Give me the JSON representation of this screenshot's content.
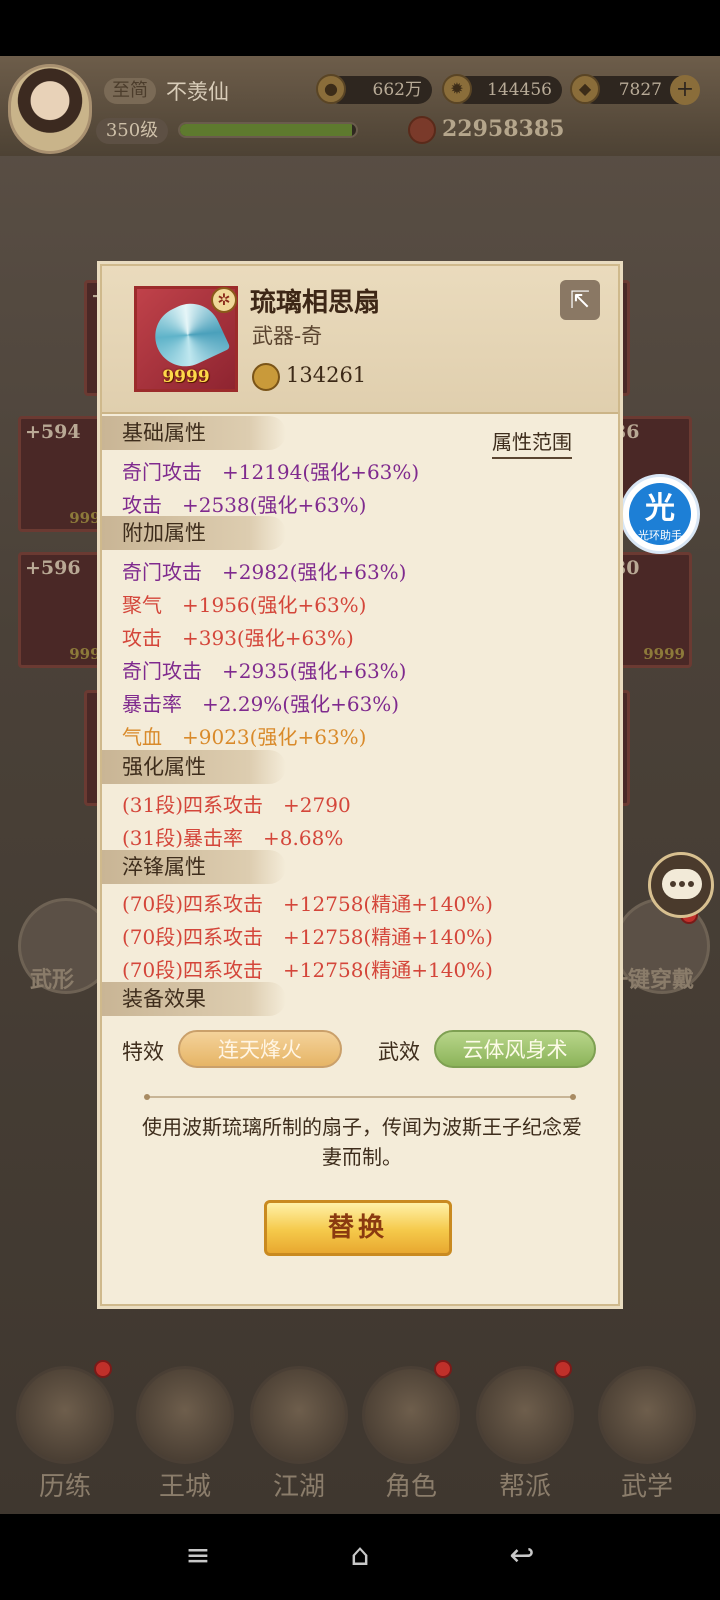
{
  "player": {
    "vip_label": "至简",
    "name": "不羡仙",
    "level": "350级",
    "exp_fraction": 0.98,
    "power": "22958385"
  },
  "resources": [
    {
      "icon": "coin-icon",
      "value": "662万"
    },
    {
      "icon": "gem-icon",
      "value": "144456"
    },
    {
      "icon": "gold-ingot-icon",
      "value": "7827"
    }
  ],
  "background_slots": [
    {
      "plus": "+594",
      "quality": "9999"
    },
    {
      "plus": "+596",
      "quality": "9999"
    },
    {
      "plus": "+5",
      "quality": ""
    },
    {
      "plus": "36",
      "quality": ""
    },
    {
      "plus": "30",
      "quality": "9999"
    }
  ],
  "background_labels": {
    "left_round": "武形",
    "right_round": "一键穿戴"
  },
  "helper": {
    "glyph": "光",
    "caption": "光环助手"
  },
  "item": {
    "name": "琉璃相思扇",
    "type": "武器-奇",
    "level_badge": "9999",
    "power": "134261",
    "attr_range_label": "属性范围"
  },
  "sections": {
    "base": "基础属性",
    "extra": "附加属性",
    "enhance": "强化属性",
    "temper": "淬锋属性",
    "effect": "装备效果"
  },
  "base_attrs": [
    "奇门攻击　+12194(强化+63%)",
    "攻击　+2538(强化+63%)"
  ],
  "extra_attrs": [
    {
      "text": "奇门攻击　+2982(强化+63%)",
      "color": "#7f2a8e"
    },
    {
      "text": "聚气　+1956(强化+63%)",
      "color": "#d4463a"
    },
    {
      "text": "攻击　+393(强化+63%)",
      "color": "#d4463a"
    },
    {
      "text": "奇门攻击　+2935(强化+63%)",
      "color": "#7f2a8e"
    },
    {
      "text": "暴击率　+2.29%(强化+63%)",
      "color": "#7f2a8e"
    },
    {
      "text": "气血　+9023(强化+63%)",
      "color": "#d98a2a"
    }
  ],
  "enhance_attrs": [
    "(31段)四系攻击　+2790",
    "(31段)暴击率　+8.68%"
  ],
  "temper_attrs": [
    "(70段)四系攻击　+12758(精通+140%)",
    "(70段)四系攻击　+12758(精通+140%)",
    "(70段)四系攻击　+12758(精通+140%)"
  ],
  "effects": {
    "special_label": "特效",
    "special_value": "连天烽火",
    "martial_label": "武效",
    "martial_value": "云体风身术"
  },
  "description": "使用波斯琉璃所制的扇子，传闻为波斯王子纪念爱妻而制。",
  "replace_button": "替换",
  "bottom_nav": [
    "历练",
    "王城",
    "江湖",
    "角色",
    "帮派",
    "武学"
  ],
  "system_nav": {
    "menu": "≡",
    "home": "⌂",
    "back": "↩"
  }
}
